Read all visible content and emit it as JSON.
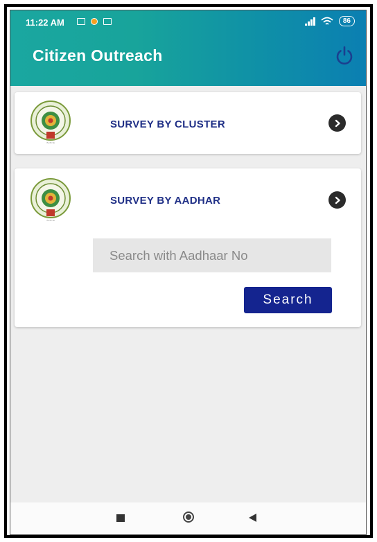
{
  "status_bar": {
    "time": "11:22 AM",
    "battery": "86",
    "icons": [
      "screen-icon",
      "notification-app-icon",
      "gallery-icon",
      "signal-icon",
      "wifi-icon",
      "battery-icon"
    ]
  },
  "app_bar": {
    "title": "Citizen Outreach",
    "power_icon": "power-icon",
    "colors": {
      "gradient_start": "#1aa7a0",
      "gradient_end": "#0b7fb2"
    }
  },
  "cards": {
    "cluster": {
      "title": "SURVEY BY CLUSTER",
      "emblem": "state-emblem-icon",
      "arrow": "chevron-right-circle-icon"
    },
    "aadhar": {
      "title": "SURVEY BY AADHAR",
      "emblem": "state-emblem-icon",
      "arrow": "chevron-right-circle-icon",
      "search_placeholder": "Search with Aadhaar No",
      "search_value": "",
      "search_button": "Search"
    }
  },
  "colors": {
    "title_text": "#1f2f86",
    "button_bg": "#14248f"
  },
  "nav_bar": {
    "icons": [
      "recents-icon",
      "home-icon",
      "back-icon"
    ]
  }
}
